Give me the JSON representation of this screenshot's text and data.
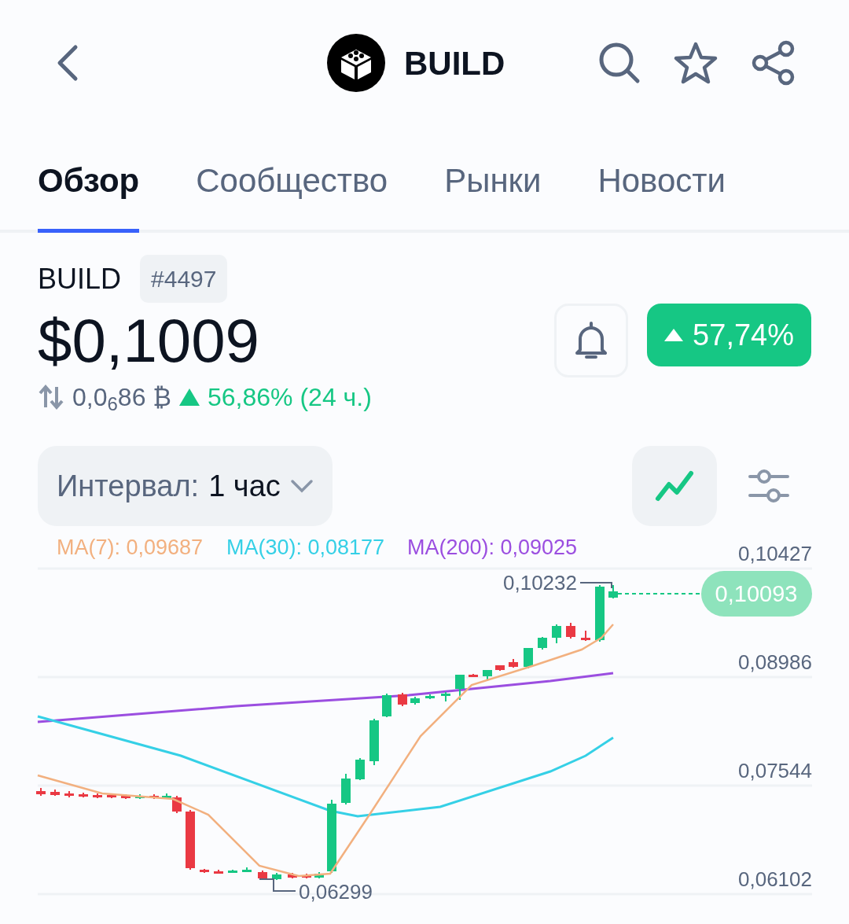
{
  "header": {
    "title": "BUILD"
  },
  "tabs": [
    {
      "label": "Обзор",
      "selected": true
    },
    {
      "label": "Сообщество",
      "selected": false
    },
    {
      "label": "Рынки",
      "selected": false
    },
    {
      "label": "Новости",
      "selected": false
    }
  ],
  "coin": {
    "symbol": "BUILD",
    "rank": "#4497",
    "price": "$0,1009",
    "change_badge": "57,74%",
    "rising": true,
    "btc_price": "0,0$_{6}$86 ₿",
    "change_24h": "56,86% (24 ч.)"
  },
  "interval": {
    "label": "Интервал:",
    "value": "1 час"
  },
  "chart": {
    "ma_legend": [
      {
        "label": "MA(7): 0,09687",
        "color": "#f2b07f"
      },
      {
        "label": "MA(30): 0,08177",
        "color": "#35d0e6"
      },
      {
        "label": "MA(200): 0,09025",
        "color": "#9b4ee0"
      }
    ],
    "y_labels": [
      "0,10427",
      "0,08986",
      "0,07544",
      "0,06102"
    ],
    "high_label": "0,10232",
    "low_label": "0,06299",
    "current_price": "0,10093"
  }
}
